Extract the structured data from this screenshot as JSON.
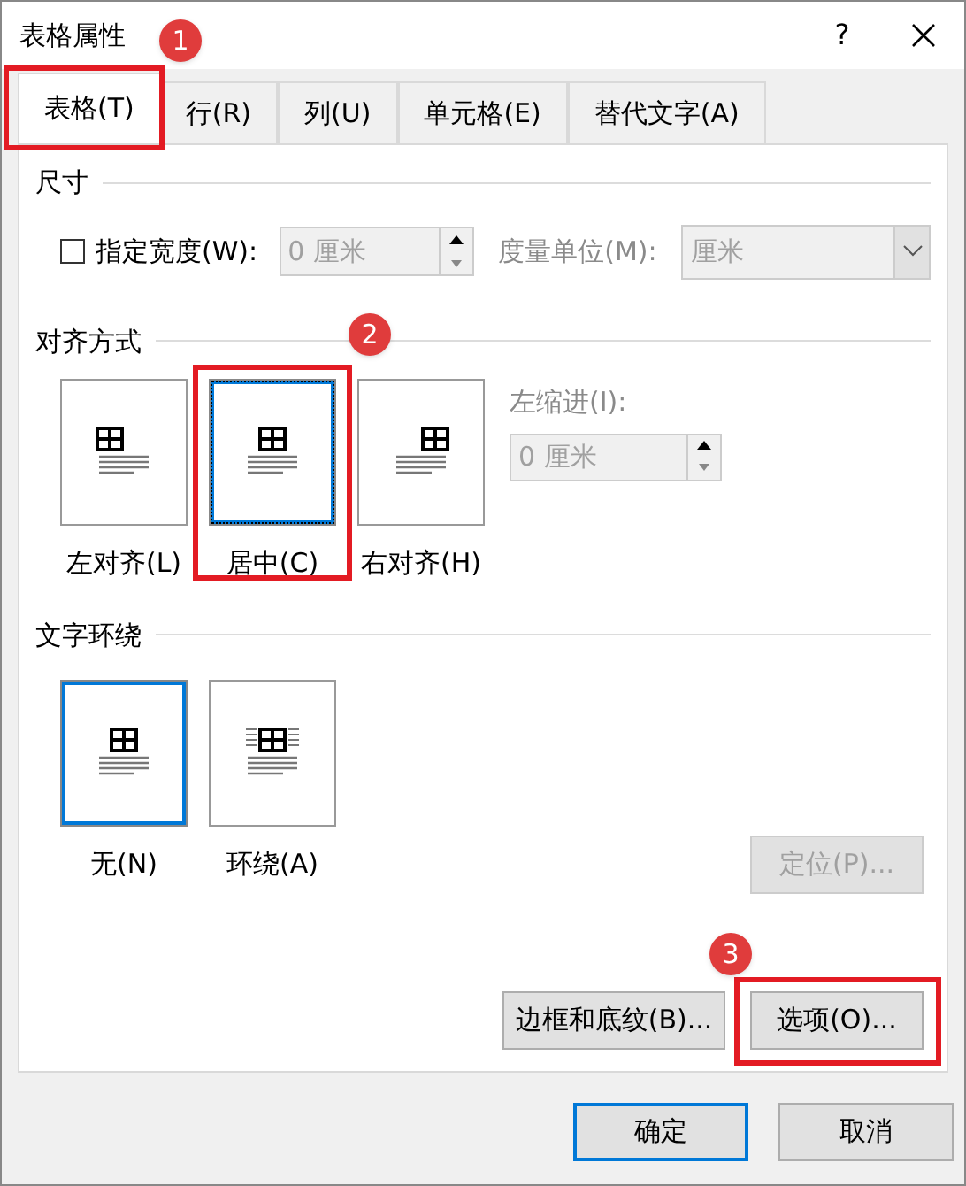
{
  "window": {
    "title": "表格属性",
    "help": "?"
  },
  "tabs": [
    {
      "label": "表格(T)",
      "selected": true,
      "annotation": "1"
    },
    {
      "label": "行(R)",
      "selected": false
    },
    {
      "label": "列(U)",
      "selected": false
    },
    {
      "label": "单元格(E)",
      "selected": false
    },
    {
      "label": "替代文字(A)",
      "selected": false
    }
  ],
  "size": {
    "heading": "尺寸",
    "width_checkbox": {
      "label": "指定宽度(W):",
      "checked": false
    },
    "width_field": {
      "value": "0 厘米",
      "disabled": true
    },
    "unit_label": "度量单位(M):",
    "unit_select": {
      "value": "厘米",
      "disabled": true
    }
  },
  "alignment": {
    "heading": "对齐方式",
    "annotation": "2",
    "options": [
      {
        "kind": "left",
        "label": "左对齐(L)",
        "selected": false
      },
      {
        "kind": "center",
        "label": "居中(C)",
        "selected": true
      },
      {
        "kind": "right",
        "label": "右对齐(H)",
        "selected": false
      }
    ],
    "indent_label": "左缩进(I):",
    "indent_field": {
      "value": "0 厘米",
      "disabled": true
    }
  },
  "wrapping": {
    "heading": "文字环绕",
    "options": [
      {
        "kind": "none",
        "label": "无(N)",
        "selected": true
      },
      {
        "kind": "around",
        "label": "环绕(A)",
        "selected": false
      }
    ],
    "position_button": {
      "label": "定位(P)...",
      "disabled": true
    }
  },
  "panel_buttons": [
    {
      "label": "边框和底纹(B)..."
    },
    {
      "label": "选项(O)...",
      "annotation": "3"
    }
  ],
  "buttons": [
    {
      "label": "确定",
      "default": true
    },
    {
      "label": "取消",
      "default": false
    }
  ]
}
